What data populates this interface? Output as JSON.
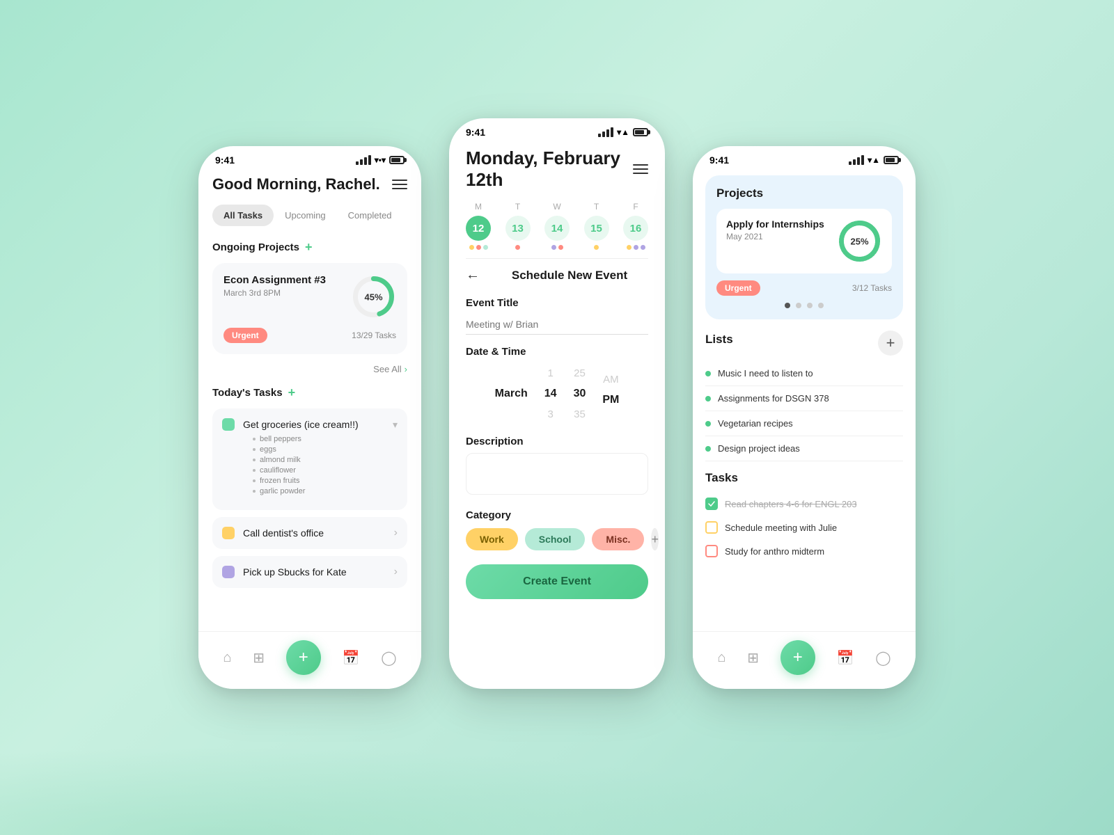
{
  "background": "#a8e6cf",
  "left_phone": {
    "status_time": "9:41",
    "greeting": "Good Morning, Rachel.",
    "tabs": [
      "All Tasks",
      "Upcoming",
      "Completed"
    ],
    "active_tab": "All Tasks",
    "ongoing_title": "Ongoing Projects",
    "project": {
      "name": "Econ Assignment #3",
      "date": "March 3rd 8PM",
      "badge": "Urgent",
      "tasks": "13/29 Tasks",
      "percent": 45
    },
    "see_all": "See All",
    "todays_tasks": "Today's Tasks",
    "tasks": [
      {
        "name": "Get groceries (ice cream!!)",
        "color": "#6ddba8",
        "type": "dropdown"
      },
      {
        "name": "Call dentist's office",
        "color": "#ffd166",
        "type": "arrow"
      },
      {
        "name": "Pick up Sbucks for Kate",
        "color": "#b0a4e3",
        "type": "arrow"
      }
    ],
    "grocery_items": [
      "bell peppers",
      "eggs",
      "almond milk",
      "cauliflower",
      "frozen fruits",
      "garlic powder"
    ],
    "nav": [
      "home",
      "grid",
      "plus",
      "calendar",
      "user"
    ]
  },
  "center_phone": {
    "status_time": "9:41",
    "date_title": "Monday, February 12th",
    "week_days": [
      {
        "label": "M",
        "num": "12",
        "active": true,
        "dots": [
          "#ffd166",
          "#ff8a80",
          "#b5ead7"
        ]
      },
      {
        "label": "T",
        "num": "13",
        "dots": [
          "#ff8a80"
        ]
      },
      {
        "label": "W",
        "num": "14",
        "dots": [
          "#b0a4e3",
          "#ff8a80"
        ]
      },
      {
        "label": "T",
        "num": "15",
        "dots": [
          "#ffd166"
        ]
      },
      {
        "label": "F",
        "num": "16",
        "dots": [
          "#ffd166",
          "#b0a4e3",
          "#b0a4e3"
        ]
      }
    ],
    "schedule_title": "Schedule New Event",
    "event_title_label": "Event Title",
    "event_title_placeholder": "Meeting w/ Brian",
    "datetime_label": "Date & Time",
    "picker": {
      "month_above": "",
      "month": "March",
      "month_below": "",
      "day_above": "1",
      "day": "14",
      "day_below": "3",
      "min_above": "25",
      "min": "30",
      "min_below": "35",
      "ampm_above": "AM",
      "ampm": "PM",
      "ampm_below": ""
    },
    "description_label": "Description",
    "description_placeholder": "",
    "category_label": "Category",
    "categories": [
      "Work",
      "School",
      "Misc."
    ],
    "create_btn": "Create Event"
  },
  "right_phone": {
    "status_time": "9:41",
    "projects_title": "Projects",
    "project": {
      "name": "Apply for Internships",
      "date": "May 2021",
      "badge": "Urgent",
      "tasks": "3/12 Tasks",
      "percent": 25
    },
    "indicator_count": 4,
    "lists_title": "Lists",
    "lists": [
      {
        "color": "#4ecb8a",
        "text": "Music I need to listen to"
      },
      {
        "color": "#4ecb8a",
        "text": "Assignments for DSGN 378"
      },
      {
        "color": "#4ecb8a",
        "text": "Vegetarian recipes"
      },
      {
        "color": "#4ecb8a",
        "text": "Design project ideas"
      }
    ],
    "tasks_title": "Tasks",
    "tasks": [
      {
        "text": "Read chapters 4-6 for ENGL 203",
        "type": "green",
        "done": true
      },
      {
        "text": "Schedule meeting with Julie",
        "type": "yellow",
        "done": false
      },
      {
        "text": "Study for anthro midterm",
        "type": "red",
        "done": false
      }
    ],
    "nav": [
      "home",
      "grid",
      "plus",
      "calendar",
      "user"
    ]
  }
}
